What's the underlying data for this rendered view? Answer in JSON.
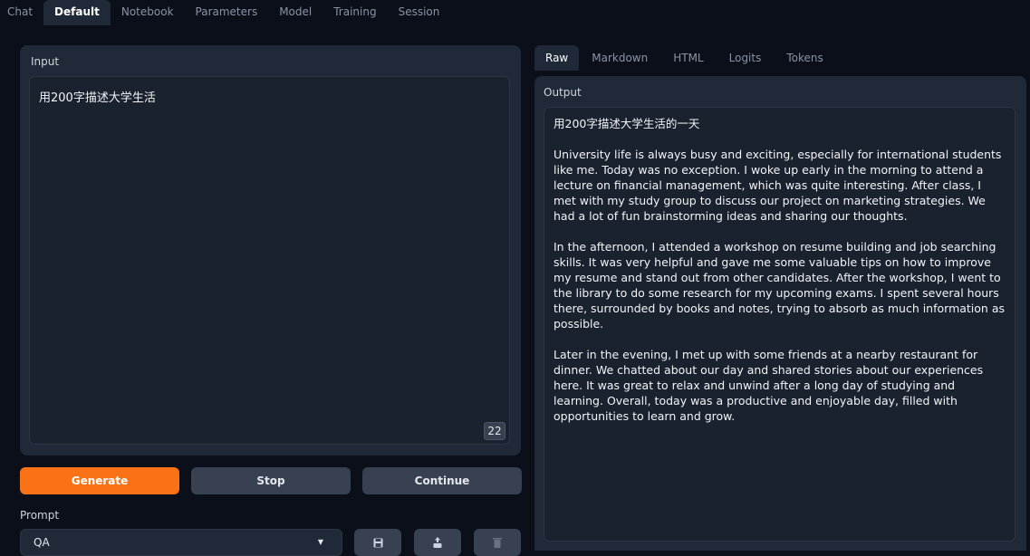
{
  "main_tabs": [
    "Chat",
    "Default",
    "Notebook",
    "Parameters",
    "Model",
    "Training",
    "Session"
  ],
  "main_active_tab": "Default",
  "input_panel": {
    "label": "Input",
    "text": "用200字描述大学生活",
    "token_count": "22"
  },
  "buttons": {
    "generate": "Generate",
    "stop": "Stop",
    "continue": "Continue"
  },
  "prompt": {
    "label": "Prompt",
    "selected": "QA",
    "icons": [
      "save-icon",
      "upload-icon",
      "delete-icon"
    ]
  },
  "output_tabs": [
    "Raw",
    "Markdown",
    "HTML",
    "Logits",
    "Tokens"
  ],
  "output_active_tab": "Raw",
  "output_panel": {
    "label": "Output",
    "paragraphs": [
      "用200字描述大学生活的一天",
      "University life is always busy and exciting, especially for international students like me. Today was no exception. I woke up early in the morning to attend a lecture on financial management, which was quite interesting. After class, I met with my study group to discuss our project on marketing strategies. We had a lot of fun brainstorming ideas and sharing our thoughts.",
      "In the afternoon, I attended a workshop on resume building and job searching skills. It was very helpful and gave me some valuable tips on how to improve my resume and stand out from other candidates. After the workshop, I went to the library to do some research for my upcoming exams. I spent several hours there, surrounded by books and notes, trying to absorb as much information as possible.",
      "Later in the evening, I met up with some friends at a nearby restaurant for dinner. We chatted about our day and shared stories about our experiences here. It was great to relax and unwind after a long day of studying and learning. Overall, today was a productive and enjoyable day, filled with opportunities to learn and grow."
    ]
  },
  "colors": {
    "background": "#0b0f19",
    "panel": "#1f2937",
    "accent": "#f97316",
    "secondary_button": "#374151"
  }
}
